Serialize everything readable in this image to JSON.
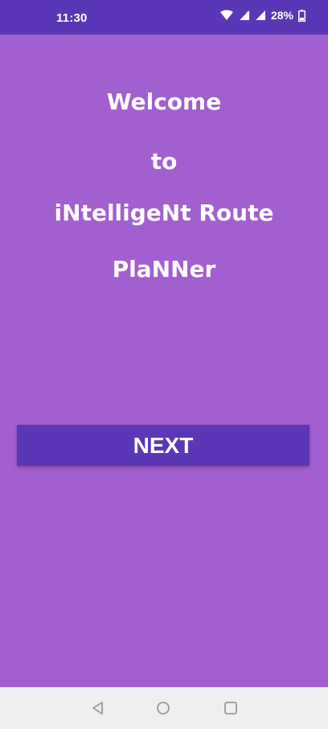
{
  "status_bar": {
    "time": "11:30",
    "battery": "28%",
    "icons": [
      "wifi-icon",
      "signal-icon",
      "signal-icon",
      "battery-icon"
    ]
  },
  "welcome": {
    "line1": "Welcome",
    "line2": "to",
    "line3": "iNtelligeNt Route",
    "line4": "PlaNNer"
  },
  "next_button": {
    "label": "NEXT"
  },
  "nav_bar": {
    "icons": [
      "back-icon",
      "home-icon",
      "recents-icon"
    ]
  },
  "colors": {
    "background": "#a25fcf",
    "accent": "#5b36b7",
    "nav_bar": "#efefef"
  }
}
